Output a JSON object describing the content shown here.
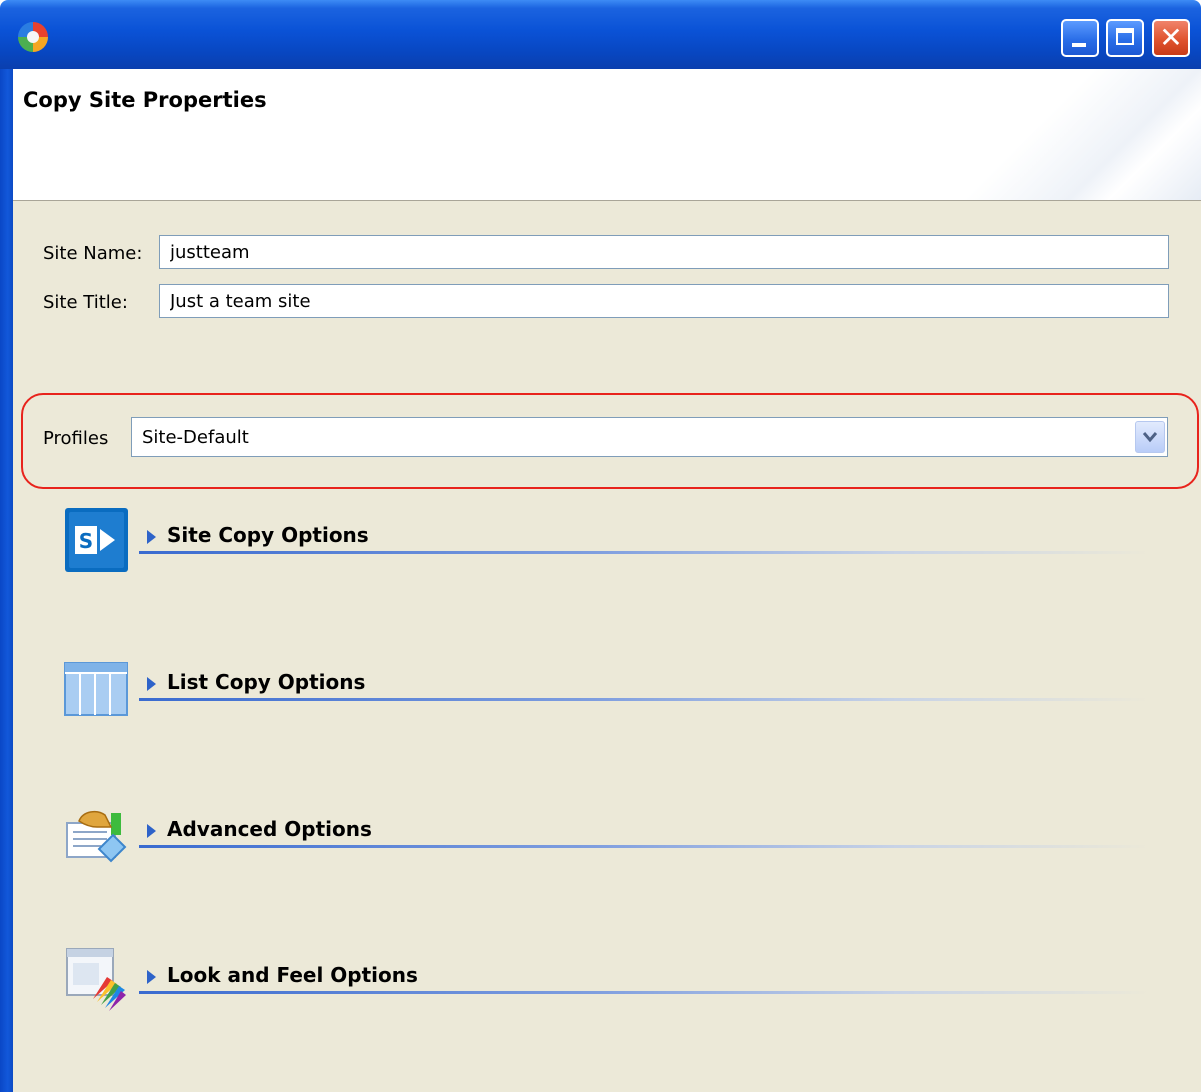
{
  "window": {
    "header_title": "Copy Site Properties"
  },
  "form": {
    "site_name_label": "Site Name:",
    "site_name_value": "justteam",
    "site_title_label": "Site Title:",
    "site_title_value": "Just a team site",
    "profiles_label": "Profiles",
    "profiles_value": "Site-Default"
  },
  "sections": [
    {
      "label": "Site Copy Options",
      "icon": "sharepoint-icon"
    },
    {
      "label": "List Copy Options",
      "icon": "list-table-icon"
    },
    {
      "label": "Advanced Options",
      "icon": "advanced-settings-icon"
    },
    {
      "label": "Look and Feel Options",
      "icon": "palette-icon"
    }
  ],
  "colors": {
    "titlebar": "#0a52d6",
    "background": "#ece9d8",
    "highlight": "#e8231c",
    "accent": "#2e63c9"
  }
}
